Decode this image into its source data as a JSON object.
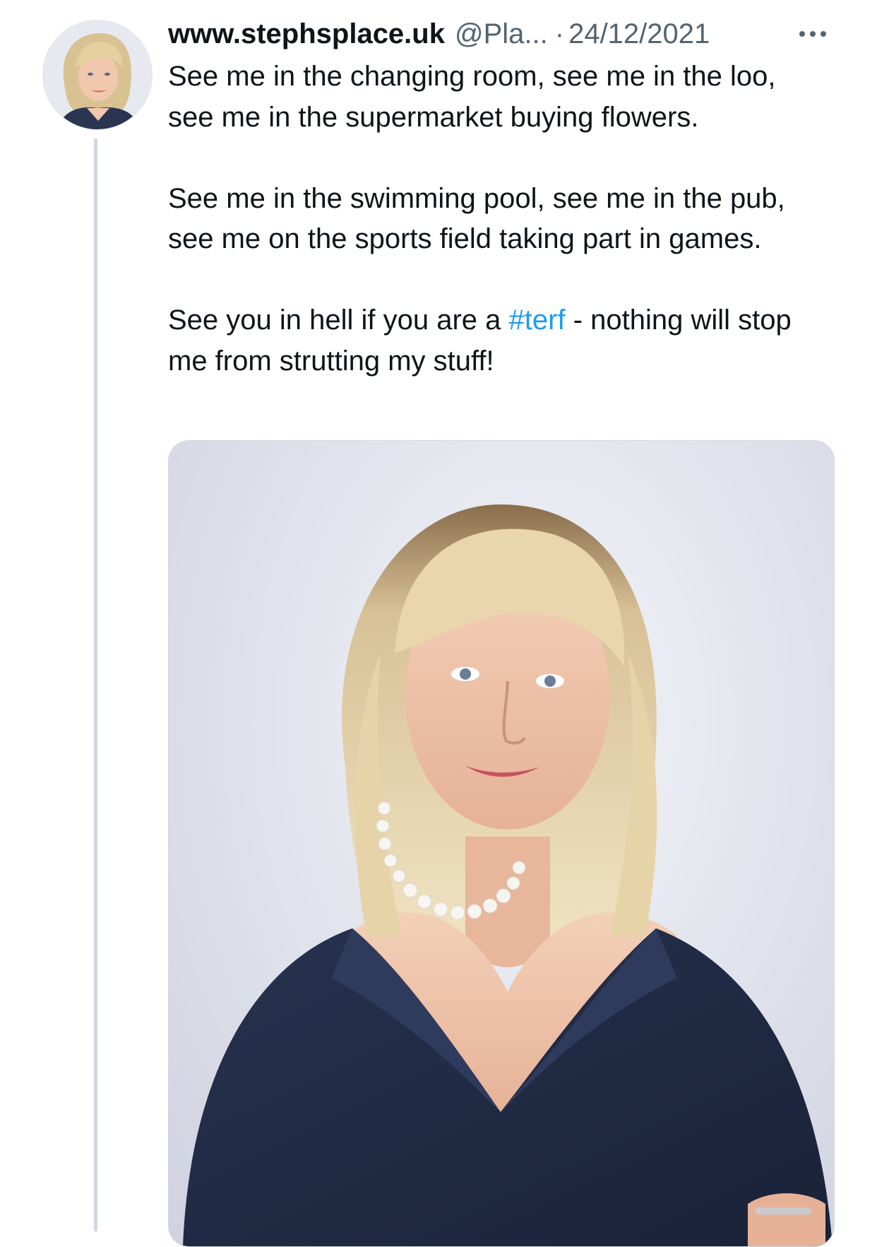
{
  "tweet": {
    "display_name": "www.stephsplace.uk",
    "handle": "@Pla...",
    "separator": "·",
    "date": "24/12/2021",
    "paragraphs": [
      {
        "text": "See me in the changing room, see me in the loo, see me in the supermarket buying flowers."
      },
      {
        "text": "See me in the swimming pool, see me in the pub, see me on the sports field taking part in games."
      },
      {
        "before": "See you in hell if you are a ",
        "hashtag": "#terf",
        "after": "  - nothing will stop me from strutting my stuff!"
      }
    ]
  },
  "icons": {
    "more": "more-horizontal-icon"
  },
  "colors": {
    "text": "#0f1419",
    "secondary": "#536471",
    "hashtag": "#1d9bf0",
    "thread_line": "#cfd9de"
  }
}
